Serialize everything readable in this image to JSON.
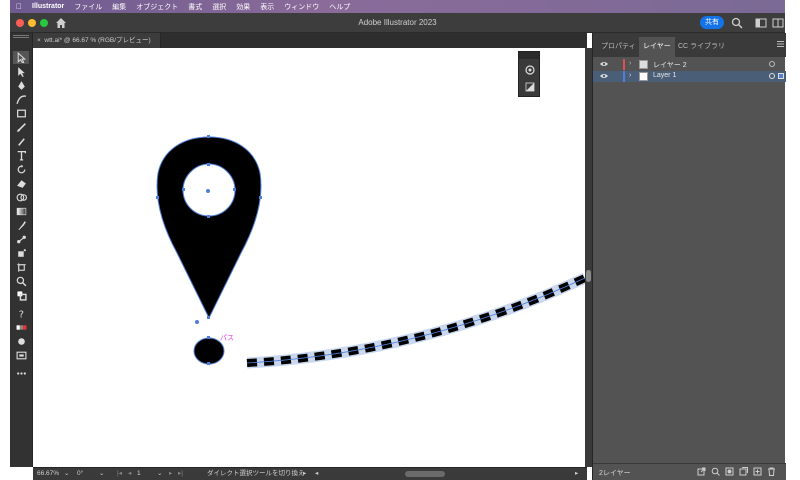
{
  "menubar": {
    "app_name": "Illustrator",
    "items": [
      "ファイル",
      "編集",
      "オブジェクト",
      "書式",
      "選択",
      "効果",
      "表示",
      "ウィンドウ",
      "ヘルプ"
    ]
  },
  "titlebar": {
    "title": "Adobe Illustrator 2023",
    "share_label": "共有"
  },
  "document_tab": {
    "close_glyph": "×",
    "label": "wtt.ai* @ 66.67 % (RGB/プレビュー)"
  },
  "canvas": {
    "smart_guide_label": "パス"
  },
  "right_panel": {
    "tabs": [
      "プロパティ",
      "レイヤー",
      "CC ライブラリ"
    ],
    "active_tab": "レイヤー",
    "layers": [
      {
        "name": "レイヤー 2",
        "color": "#e05050",
        "selected": false
      },
      {
        "name": "Layer 1",
        "color": "#4f7fd9",
        "selected": true
      }
    ],
    "footer_count": "2レイヤー"
  },
  "statusbar": {
    "zoom": "66.67%",
    "rotation": "0°",
    "artboard": "1",
    "message": "ダイレクト選択ツールを切り換え"
  },
  "colors": {
    "accent": "#1473e6",
    "path_selection": "#4f7fd9",
    "smart_guide": "#e040e0"
  },
  "icons": {
    "home": "home-icon",
    "search": "search-icon",
    "workspace": "workspace-icon",
    "menu": "menu-icon"
  }
}
